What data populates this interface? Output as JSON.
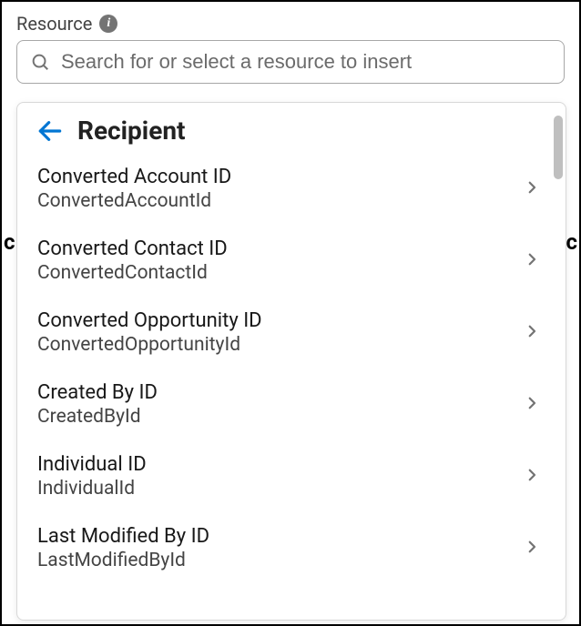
{
  "field": {
    "label": "Resource",
    "search_placeholder": "Search for or select a resource to insert"
  },
  "dropdown": {
    "header_title": "Recipient",
    "items": [
      {
        "label": "Converted Account ID",
        "api": "ConvertedAccountId"
      },
      {
        "label": "Converted Contact ID",
        "api": "ConvertedContactId"
      },
      {
        "label": "Converted Opportunity ID",
        "api": "ConvertedOpportunityId"
      },
      {
        "label": "Created By ID",
        "api": "CreatedById"
      },
      {
        "label": "Individual ID",
        "api": "IndividualId"
      },
      {
        "label": "Last Modified By ID",
        "api": "LastModifiedById"
      }
    ]
  },
  "background": {
    "left": "c",
    "right": "c"
  }
}
